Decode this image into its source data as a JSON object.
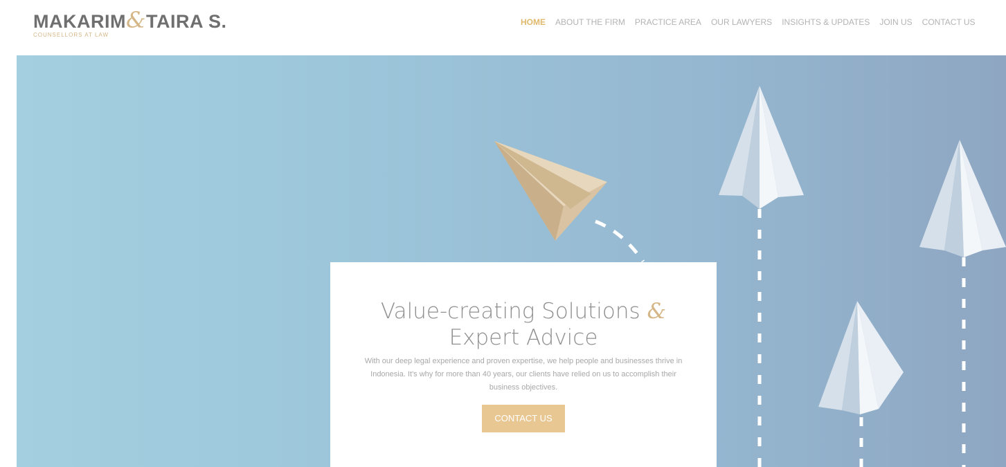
{
  "logo": {
    "name_part1": "MAKARIM",
    "amp": "&",
    "name_part2": "TAIRA S.",
    "tagline": "COUNSELLORS AT LAW"
  },
  "nav": {
    "items": [
      {
        "label": "HOME"
      },
      {
        "label": "ABOUT THE FIRM"
      },
      {
        "label": "PRACTICE AREA"
      },
      {
        "label": "OUR LAWYERS"
      },
      {
        "label": "INSIGHTS & UPDATES"
      },
      {
        "label": "JOIN US"
      },
      {
        "label": "CONTACT US"
      }
    ],
    "active_index": 0
  },
  "hero": {
    "title_line1": "Value-creating Solutions",
    "title_amp": "&",
    "title_line2": "Expert Advice",
    "body": "With our deep legal experience and proven expertise, we help people and businesses thrive in Indonesia. It's why for more than 40 years, our clients have relied on us to accomplish their business objectives.",
    "cta_label": "CONTACT US"
  },
  "colors": {
    "accent": "#d5b787",
    "nav_active": "#e0b96c",
    "cta_bg": "#e8c793",
    "logo_text": "#6f6f6f",
    "hero_bg_left": "#a3cfe0",
    "hero_bg_right": "#8ea6c2"
  },
  "icons": [
    "paper-plane-gold-icon",
    "paper-plane-white-icon"
  ]
}
